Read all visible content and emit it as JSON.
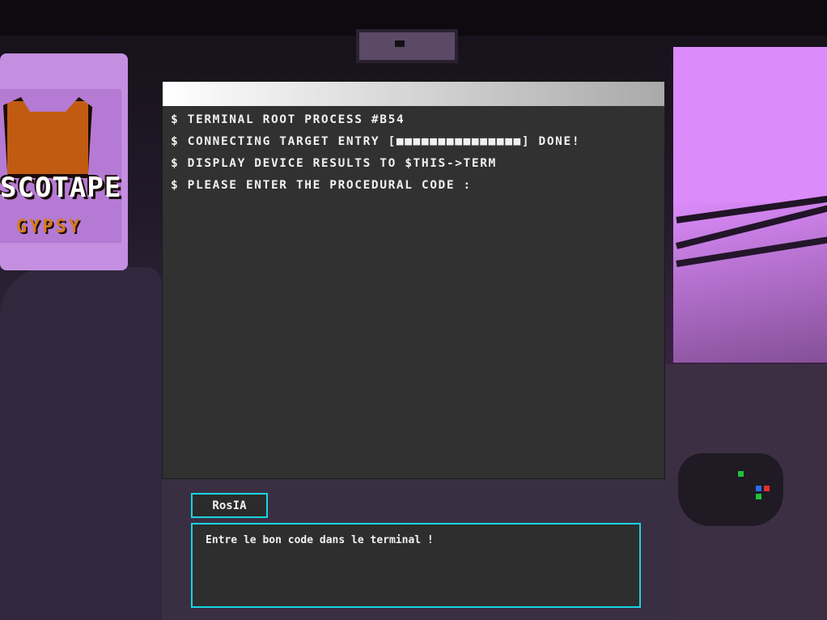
{
  "terminal": {
    "title": "",
    "lines": [
      "$ TERMINAL ROOT PROCESS #B54",
      "$ CONNECTING TARGET ENTRY [■■■■■■■■■■■■■■■] DONE!",
      "$ DISPLAY DEVICE RESULTS TO $THIS->TERM",
      "$ PLEASE ENTER THE PROCEDURAL CODE :"
    ]
  },
  "dialog": {
    "speaker": "RosIA",
    "text": "Entre le bon code dans le terminal !"
  },
  "background": {
    "sticker_text": "SCOTAPE",
    "sticker_subtext": "GYPSY"
  },
  "colors": {
    "terminal_bg": "#313131",
    "dialog_border": "#17d6e0",
    "accent_pink": "#a512c8",
    "wall_pink": "#dc8bfa"
  }
}
